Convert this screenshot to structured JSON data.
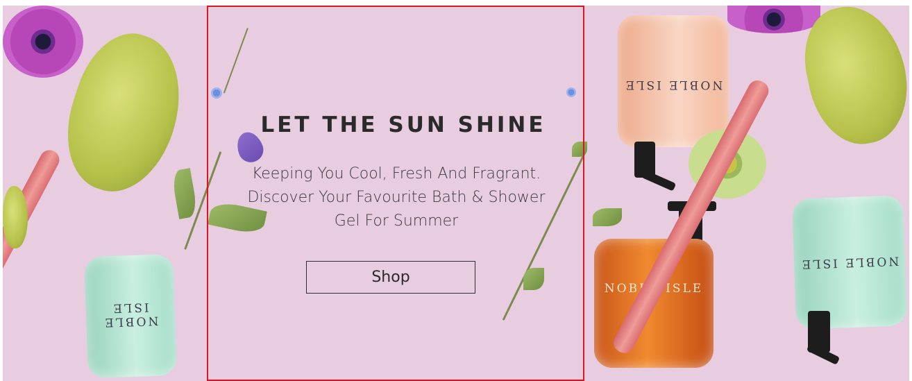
{
  "banner": {
    "headline": "LET THE SUN SHINE",
    "subtext": "Keeping You Cool, Fresh And Fragrant. Discover Your Favourite Bath & Shower Gel For Summer",
    "cta_label": "Shop"
  },
  "products": {
    "brand_label": "NOBLE ISLE"
  },
  "colors": {
    "background": "#e8cde0",
    "selection_outline": "#e0141e",
    "text": "#2a2a2a"
  },
  "icons": [
    "anemone-flower-icon",
    "hellebore-flower-icon",
    "rhubarb-stalk-icon",
    "bluebell-flower-icon",
    "pump-bottle-icon"
  ]
}
